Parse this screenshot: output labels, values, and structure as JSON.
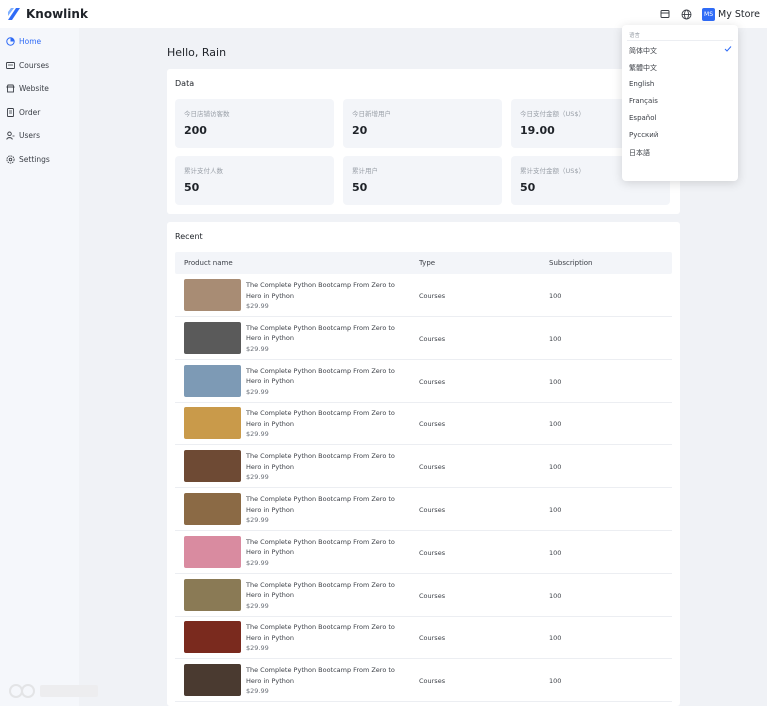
{
  "app": {
    "name": "Knowlink"
  },
  "topbar": {
    "icons": [
      "store-icon",
      "globe-icon"
    ],
    "store": {
      "avatar": "MS",
      "name": "My Store"
    }
  },
  "sidebar": {
    "items": [
      {
        "label": "Home",
        "icon": "home-icon",
        "active": true
      },
      {
        "label": "Courses",
        "icon": "courses-icon",
        "active": false
      },
      {
        "label": "Website",
        "icon": "website-icon",
        "active": false
      },
      {
        "label": "Order",
        "icon": "order-icon",
        "active": false
      },
      {
        "label": "Users",
        "icon": "users-icon",
        "active": false
      },
      {
        "label": "Settings",
        "icon": "settings-icon",
        "active": false
      }
    ]
  },
  "greeting": "Hello, Rain",
  "data": {
    "title": "Data",
    "stats": [
      {
        "label": "今日店铺访客数",
        "value": "200"
      },
      {
        "label": "今日新增用户",
        "value": "20"
      },
      {
        "label": "今日支付金额（US$）",
        "value": "19.00"
      },
      {
        "label": "累计支付人数",
        "value": "50"
      },
      {
        "label": "累计用户",
        "value": "50"
      },
      {
        "label": "累计支付金额（US$）",
        "value": "50"
      }
    ]
  },
  "recent": {
    "title": "Recent",
    "columns": {
      "product": "Product name",
      "type": "Type",
      "subscription": "Subscription"
    },
    "rows": [
      {
        "name": "The Complete Python Bootcamp From Zero to Hero in Python",
        "price": "$29.99",
        "type": "Courses",
        "subscription": "100",
        "thumb_color": "#a88c74"
      },
      {
        "name": "The Complete Python Bootcamp From Zero to Hero in Python",
        "price": "$29.99",
        "type": "Courses",
        "subscription": "100",
        "thumb_color": "#5a5a5a"
      },
      {
        "name": "The Complete Python Bootcamp From Zero to Hero in Python",
        "price": "$29.99",
        "type": "Courses",
        "subscription": "100",
        "thumb_color": "#7d9ab5"
      },
      {
        "name": "The Complete Python Bootcamp From Zero to Hero in Python",
        "price": "$29.99",
        "type": "Courses",
        "subscription": "100",
        "thumb_color": "#c99a4a"
      },
      {
        "name": "The Complete Python Bootcamp From Zero to Hero in Python",
        "price": "$29.99",
        "type": "Courses",
        "subscription": "100",
        "thumb_color": "#6e4a34"
      },
      {
        "name": "The Complete Python Bootcamp From Zero to Hero in Python",
        "price": "$29.99",
        "type": "Courses",
        "subscription": "100",
        "thumb_color": "#8b6a45"
      },
      {
        "name": "The Complete Python Bootcamp From Zero to Hero in Python",
        "price": "$29.99",
        "type": "Courses",
        "subscription": "100",
        "thumb_color": "#d98ba0"
      },
      {
        "name": "The Complete Python Bootcamp From Zero to Hero in Python",
        "price": "$29.99",
        "type": "Courses",
        "subscription": "100",
        "thumb_color": "#8a7a55"
      },
      {
        "name": "The Complete Python Bootcamp From Zero to Hero in Python",
        "price": "$29.99",
        "type": "Courses",
        "subscription": "100",
        "thumb_color": "#7a2a1e"
      },
      {
        "name": "The Complete Python Bootcamp From Zero to Hero in Python",
        "price": "$29.99",
        "type": "Courses",
        "subscription": "100",
        "thumb_color": "#4a3a30"
      }
    ]
  },
  "language_menu": {
    "header": "语言",
    "items": [
      {
        "label": "简体中文",
        "selected": true
      },
      {
        "label": "繁體中文",
        "selected": false
      },
      {
        "label": "English",
        "selected": false
      },
      {
        "label": "Français",
        "selected": false
      },
      {
        "label": "Español",
        "selected": false
      },
      {
        "label": "Русский",
        "selected": false
      },
      {
        "label": "日本語",
        "selected": false
      }
    ]
  },
  "colors": {
    "accent": "#2f6bf6",
    "background": "#f0f2f6"
  }
}
